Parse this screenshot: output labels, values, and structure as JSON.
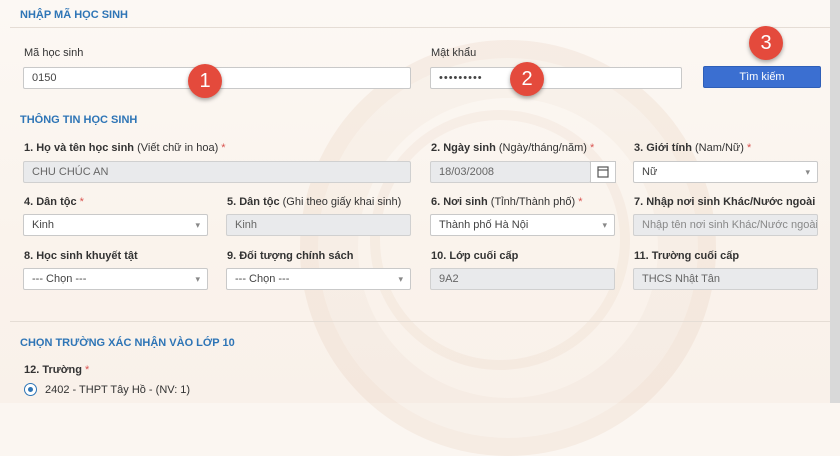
{
  "section_input": {
    "title": "NHẬP MÃ HỌC SINH",
    "student_code_label": "Mã học sinh",
    "student_code_value": "0150",
    "password_label": "Mật khẩu",
    "password_value": "•••••••••",
    "search_button": "Tìm kiếm"
  },
  "markers": [
    "1",
    "2",
    "3"
  ],
  "section_info": {
    "title": "THÔNG TIN HỌC SINH",
    "fields": {
      "full_name": {
        "label_bold": "1. Họ và tên học sinh",
        "label_rest": " (Viết chữ in hoa)",
        "required": true,
        "value": "CHU CHÚC AN"
      },
      "dob": {
        "label_bold": "2. Ngày sinh",
        "label_rest": " (Ngày/tháng/năm)",
        "required": true,
        "value": "18/03/2008"
      },
      "gender": {
        "label_bold": "3. Giới tính",
        "label_rest": " (Nam/Nữ)",
        "required": true,
        "value": "Nữ"
      },
      "ethnicity": {
        "label_bold": "4. Dân tộc",
        "label_rest": "",
        "required": true,
        "value": "Kinh"
      },
      "ethnicity_cert": {
        "label_bold": "5. Dân tộc",
        "label_rest": " (Ghi theo giấy khai sinh)",
        "required": false,
        "value": "Kinh"
      },
      "birthplace": {
        "label_bold": "6. Nơi sinh",
        "label_rest": " (Tỉnh/Thành phố)",
        "required": true,
        "value": "Thành phố Hà Nội"
      },
      "birthplace_other": {
        "label_bold": "7. Nhập nơi sinh Khác/Nước ngoài",
        "label_rest": "",
        "required": false,
        "placeholder": "Nhập tên nơi sinh Khác/Nước ngoài"
      },
      "disability": {
        "label_bold": "8. Học sinh khuyết tật",
        "label_rest": "",
        "required": false,
        "value": "--- Chọn ---"
      },
      "policy": {
        "label_bold": "9. Đối tượng chính sách",
        "label_rest": "",
        "required": false,
        "value": "--- Chọn ---"
      },
      "last_class": {
        "label_bold": "10. Lớp cuối cấp",
        "label_rest": "",
        "required": false,
        "value": "9A2"
      },
      "last_school": {
        "label_bold": "11. Trường cuối cấp",
        "label_rest": "",
        "required": false,
        "value": "THCS Nhật Tân"
      }
    }
  },
  "section_school": {
    "title": "CHỌN TRƯỜNG XÁC NHẬN VÀO LỚP 10",
    "school_label": "12. Trường",
    "school_required": true,
    "school_option": "2402 - THPT Tây Hồ - (NV: 1)"
  },
  "colors": {
    "accent": "#2e75b6",
    "button": "#3b6fd1",
    "marker": "#e44a3c",
    "required": "#d9534f"
  }
}
